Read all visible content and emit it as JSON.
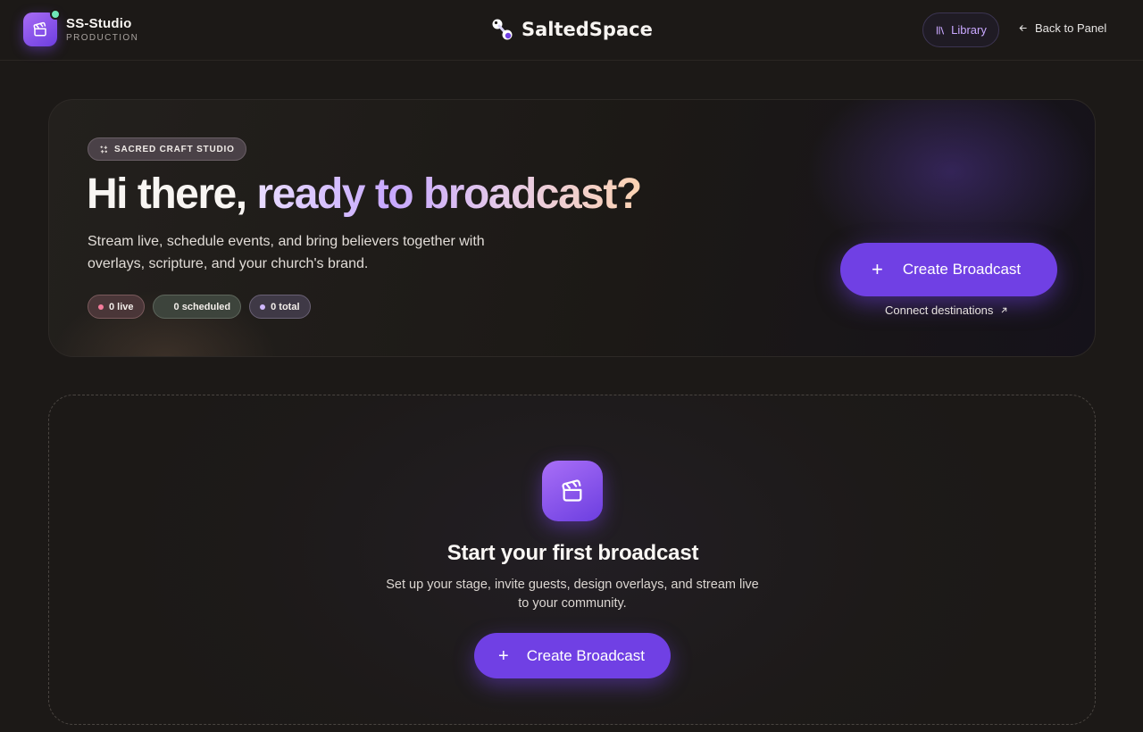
{
  "header": {
    "brand_name": "SS-Studio",
    "brand_sub": "PRODUCTION",
    "app_name": "SaltedSpace",
    "library_label": "Library",
    "back_label": "Back to Panel"
  },
  "hero": {
    "badge": "SACRED CRAFT STUDIO",
    "title_plain": "Hi there, ",
    "title_gradient": "ready to broadcast?",
    "description": "Stream live, schedule events, and bring believers together with overlays, scripture, and your church's brand.",
    "stats": {
      "live": "0 live",
      "scheduled": "0 scheduled",
      "total": "0 total"
    },
    "create_label": "Create Broadcast",
    "connect_label": "Connect destinations"
  },
  "empty_state": {
    "title": "Start your first broadcast",
    "description": "Set up your stage, invite guests, design overlays, and stream live to your community.",
    "create_label": "Create Broadcast"
  },
  "icons": {
    "brand": "clapperboard-icon",
    "library": "library-icon",
    "back": "arrow-left-icon",
    "badge": "sparkles-icon",
    "create": "plus-icon",
    "connect": "arrow-up-right-icon",
    "empty": "clapperboard-icon"
  },
  "colors": {
    "accent": "#7040e4",
    "background": "#1c1917",
    "live_dot": "#f47c9b",
    "total_dot": "#d0b8ff",
    "status_online": "#6ee7b7"
  }
}
